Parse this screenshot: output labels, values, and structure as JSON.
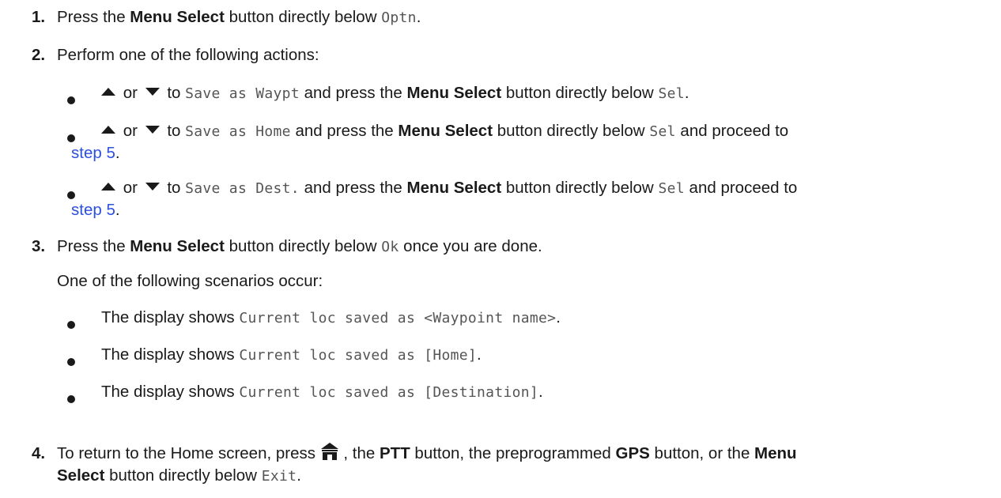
{
  "steps": {
    "s1": {
      "number": "1.",
      "pre": "Press the ",
      "bold": "Menu Select",
      "post": " button directly below ",
      "code": "Optn",
      "end": "."
    },
    "s2": {
      "number": "2.",
      "text": "Perform one of the following actions:",
      "bullets": [
        {
          "or": " or ",
          "to": " to ",
          "code1": "Save as Waypt",
          "mid": " and press the ",
          "bold": "Menu Select",
          "post": " button directly below ",
          "code2": "Sel",
          "end": "."
        },
        {
          "or": " or ",
          "to": " to ",
          "code1": "Save as Home",
          "mid": " and press the ",
          "bold": "Menu Select",
          "post": " button directly below ",
          "code2": "Sel",
          "tail": " and proceed to",
          "link": "step 5",
          "end": "."
        },
        {
          "or": " or ",
          "to": " to ",
          "code1": "Save as Dest.",
          "mid": " and press the ",
          "bold": "Menu Select",
          "post": " button directly below ",
          "code2": "Sel",
          "tail": " and proceed to",
          "link": "step 5",
          "end": "."
        }
      ]
    },
    "s3": {
      "number": "3.",
      "pre": "Press the ",
      "bold": "Menu Select",
      "post": " button directly below ",
      "code": "Ok",
      "end": " once you are done.",
      "sub": "One of the following scenarios occur:",
      "bullets": [
        {
          "pre": "The display shows ",
          "code": "Current loc saved as <Waypoint name>",
          "end": "."
        },
        {
          "pre": "The display shows ",
          "code": "Current loc saved as [Home]",
          "end": "."
        },
        {
          "pre": "The display shows ",
          "code": "Current loc saved as [Destination]",
          "end": "."
        }
      ]
    },
    "s4": {
      "number": "4.",
      "pre": "To return to the Home screen, press ",
      "mid1": " , the ",
      "bold1": "PTT",
      "mid2": " button, the preprogrammed ",
      "bold2": "GPS",
      "mid3": " button, or the ",
      "bold3a": "Menu",
      "bold3b": "Select",
      "post": " button directly below ",
      "code": "Exit",
      "end": "."
    }
  },
  "icons": {
    "up": "up-arrow-icon",
    "down": "down-arrow-icon",
    "home": "home-icon"
  }
}
